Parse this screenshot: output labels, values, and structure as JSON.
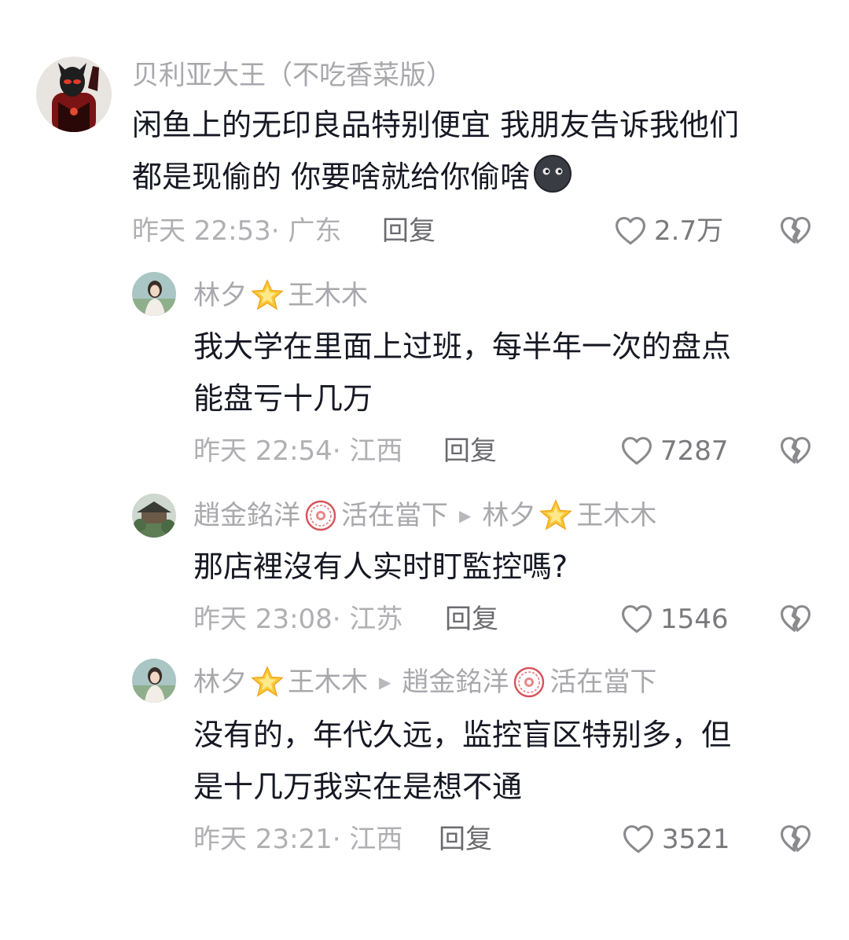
{
  "comments": [
    {
      "author": "贝利亚大王（不吃香菜版）",
      "text_lines": [
        "闲鱼上的无印良品特别便宜 我朋友告诉我他们",
        "都是现偷的 你要啥就给你偷啥"
      ],
      "emoji": "dark-face-emoji",
      "time_location": "昨天 22:53· 广东",
      "reply_label": "回复",
      "likes": "2.7万",
      "avatar": "ultraman-belial-avatar"
    },
    {
      "author_part1": "林夕",
      "author_badge": "star-badge-icon",
      "author_part2": "王木木",
      "text_lines": [
        "我大学在里面上过班，每半年一次的盘点",
        "能盘亏十几万"
      ],
      "time_location": "昨天 22:54· 江西",
      "reply_label": "回复",
      "likes": "7287",
      "avatar": "girl-photo-avatar"
    },
    {
      "author_part1": "趙金銘洋",
      "author_badge": "red-seal-badge-icon",
      "author_part2": "活在當下",
      "reply_to_part1": "林夕",
      "reply_to_badge": "star-badge-icon",
      "reply_to_part2": "王木木",
      "text_lines": [
        "那店裡沒有人实时盯監控嗎?"
      ],
      "time_location": "昨天 23:08· 江苏",
      "reply_label": "回复",
      "likes": "1546",
      "avatar": "pavilion-photo-avatar"
    },
    {
      "author_part1": "林夕",
      "author_badge": "star-badge-icon",
      "author_part2": "王木木",
      "reply_to_part1": "趙金銘洋",
      "reply_to_badge": "red-seal-badge-icon",
      "reply_to_part2": "活在當下",
      "text_lines": [
        "没有的，年代久远，监控盲区特别多，但",
        "是十几万我实在是想不通"
      ],
      "time_location": "昨天 23:21· 江西",
      "reply_label": "回复",
      "likes": "3521",
      "avatar": "girl-photo-avatar"
    }
  ],
  "colors": {
    "text": "#161823",
    "meta": "#b0b0b4",
    "name": "#a8a8ad",
    "background": "#ffffff"
  }
}
